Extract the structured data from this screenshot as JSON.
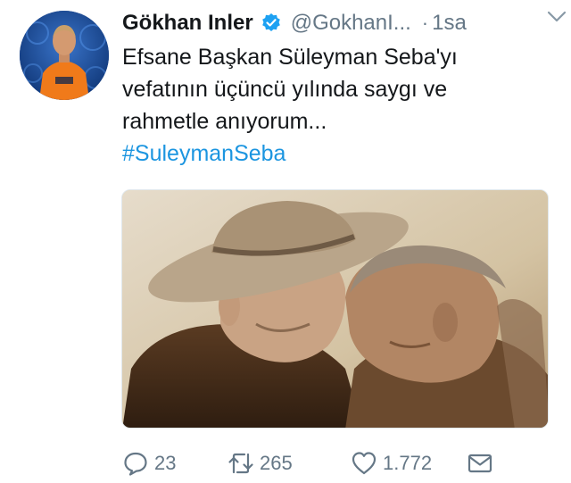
{
  "tweet": {
    "display_name": "Gökhan Inler",
    "handle": "@GokhanI...",
    "separator": "·",
    "time": "1sa",
    "text_lines": [
      "Efsane Başkan Süleyman Seba'yı",
      "vefatının üçüncü yılında saygı ve",
      "rahmetle anıyorum..."
    ],
    "hashtag": "#SuleymanSeba"
  },
  "actions": {
    "reply_count": "23",
    "retweet_count": "265",
    "like_count": "1.772"
  },
  "colors": {
    "accent": "#1b95e0",
    "muted": "#657786",
    "text": "#14171a"
  },
  "icons": {
    "verified": "verified-badge-icon",
    "chevron": "chevron-down-icon",
    "reply": "reply-icon",
    "retweet": "retweet-icon",
    "like": "heart-icon",
    "dm": "envelope-icon"
  }
}
